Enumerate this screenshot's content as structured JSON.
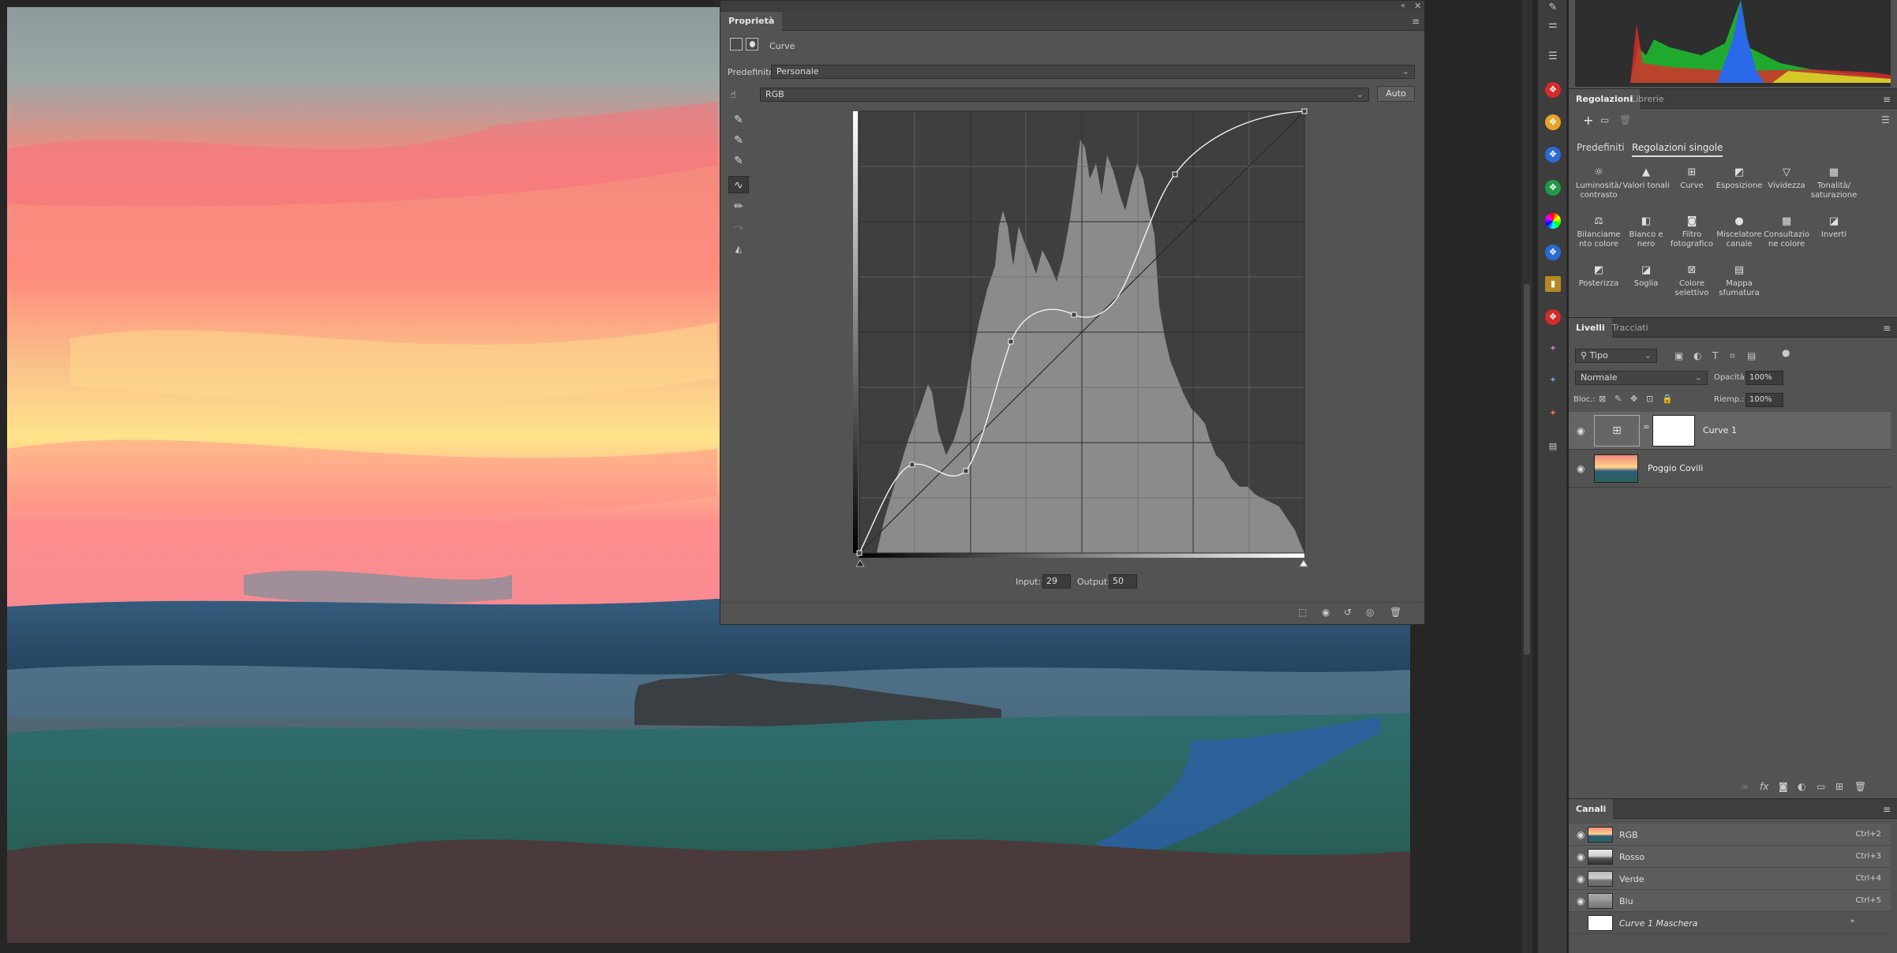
{
  "properties": {
    "title": "Proprietà",
    "adjustment_label": "Curve",
    "preset_label": "Predefinito:",
    "preset_value": "Personale",
    "channel_value": "RGB",
    "auto_label": "Auto",
    "input_label": "Input:",
    "input_value": "29",
    "output_label": "Output:",
    "output_value": "50"
  },
  "adjustments": {
    "tabs": [
      "Regolazioni",
      "Librerie"
    ],
    "subtabs": [
      "Predefiniti",
      "Regolazioni singole"
    ],
    "items": [
      {
        "label": "Luminosità/ contrasto",
        "icon": "sun-icon"
      },
      {
        "label": "Valori tonali",
        "icon": "levels-icon"
      },
      {
        "label": "Curve",
        "icon": "curves-icon"
      },
      {
        "label": "Esposizione",
        "icon": "exposure-icon"
      },
      {
        "label": "Vividezza",
        "icon": "vibrance-icon"
      },
      {
        "label": "Tonalità/ saturazione",
        "icon": "hue-icon"
      },
      {
        "label": "Bilanciame nto colore",
        "icon": "balance-icon"
      },
      {
        "label": "Bianco e nero",
        "icon": "bw-icon"
      },
      {
        "label": "Filtro fotografico",
        "icon": "camera-icon"
      },
      {
        "label": "Miscelatore canale",
        "icon": "mixer-icon"
      },
      {
        "label": "Consultazio ne colore",
        "icon": "lookup-icon"
      },
      {
        "label": "Inverti",
        "icon": "invert-icon"
      },
      {
        "label": "Posterizza",
        "icon": "posterize-icon"
      },
      {
        "label": "Soglia",
        "icon": "threshold-icon"
      },
      {
        "label": "Colore selettivo",
        "icon": "selective-icon"
      },
      {
        "label": "Mappa sfumatura",
        "icon": "gradient-map-icon"
      }
    ]
  },
  "layers": {
    "tabs": [
      "Livelli",
      "Tracciati"
    ],
    "filter_value": "Tipo",
    "blend_mode": "Normale",
    "opacity_label": "Opacità:",
    "opacity_value": "100%",
    "lock_label": "Bloc.:",
    "fill_label": "Riemp.:",
    "fill_value": "100%",
    "items": [
      {
        "name": "Curve 1"
      },
      {
        "name": "Poggio Covili"
      }
    ]
  },
  "channels": {
    "tab": "Canali",
    "items": [
      {
        "name": "RGB",
        "shortcut": "Ctrl+2"
      },
      {
        "name": "Rosso",
        "shortcut": "Ctrl+3"
      },
      {
        "name": "Verde",
        "shortcut": "Ctrl+4"
      },
      {
        "name": "Blu",
        "shortcut": "Ctrl+5"
      },
      {
        "name": "Curve 1 Maschera",
        "shortcut": "*"
      }
    ]
  }
}
